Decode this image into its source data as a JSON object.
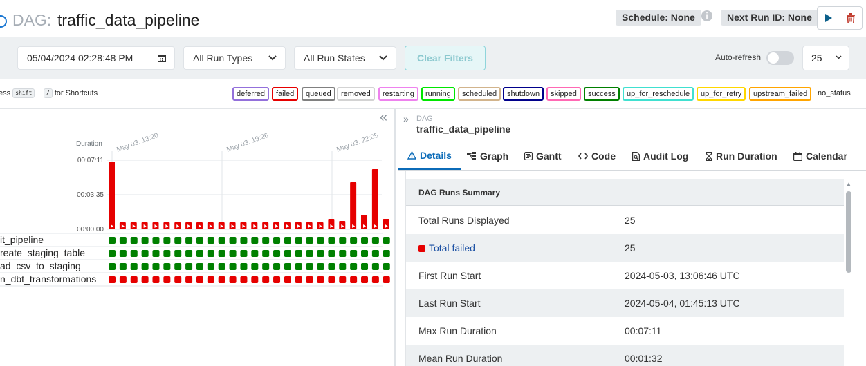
{
  "header": {
    "dag_prefix": "DAG:",
    "dag_title": "traffic_data_pipeline",
    "schedule": "Schedule: None",
    "next_run": "Next Run ID: None",
    "info_icon": "i"
  },
  "filters": {
    "date": "05/04/2024 02:28:48 PM",
    "run_types": "All Run Types",
    "run_states": "All Run States",
    "clear": "Clear Filters",
    "auto_refresh": "Auto-refresh",
    "auto_refresh_on": false,
    "page_size": "25"
  },
  "shortcuts": {
    "prefix": "ess",
    "key1": "shift",
    "plus": "+",
    "key2": "/",
    "suffix": "for Shortcuts"
  },
  "legend": [
    {
      "label": "deferred",
      "color": "#9370db"
    },
    {
      "label": "failed",
      "color": "#e60000"
    },
    {
      "label": "queued",
      "color": "#808080"
    },
    {
      "label": "removed",
      "color": "#d3d3d3"
    },
    {
      "label": "restarting",
      "color": "#ee82ee"
    },
    {
      "label": "running",
      "color": "#00e600"
    },
    {
      "label": "scheduled",
      "color": "#d2b48c"
    },
    {
      "label": "shutdown",
      "color": "#00008b"
    },
    {
      "label": "skipped",
      "color": "#ff69b4"
    },
    {
      "label": "success",
      "color": "#008000"
    },
    {
      "label": "up_for_reschedule",
      "color": "#40e0d0"
    },
    {
      "label": "up_for_retry",
      "color": "#ffd700"
    },
    {
      "label": "upstream_failed",
      "color": "#ffa500"
    }
  ],
  "no_status": "no_status",
  "grid": {
    "duration_label": "Duration",
    "y_ticks": [
      "00:07:11",
      "00:03:35",
      "00:00:00"
    ],
    "date_labels": [
      "May 03, 13:20",
      "May 03, 19:26",
      "May 03, 22:05"
    ],
    "run_durations": [
      0.98,
      0.1,
      0.1,
      0.1,
      0.1,
      0.1,
      0.1,
      0.1,
      0.1,
      0.1,
      0.1,
      0.1,
      0.1,
      0.1,
      0.1,
      0.1,
      0.1,
      0.1,
      0.1,
      0.1,
      0.15,
      0.12,
      0.68,
      0.21,
      0.87,
      0.15,
      0.4
    ],
    "tasks": [
      {
        "label": "it_pipeline",
        "status": "success"
      },
      {
        "label": "reate_staging_table",
        "status": "success"
      },
      {
        "label": "ad_csv_to_staging",
        "status": "success"
      },
      {
        "label": "n_dbt_transformations",
        "status": "failed"
      }
    ]
  },
  "panel": {
    "dag_small": "DAG",
    "dag_name": "traffic_data_pipeline",
    "tabs": [
      "Details",
      "Graph",
      "Gantt",
      "Code",
      "Audit Log",
      "Run Duration",
      "Calendar"
    ],
    "summary_title": "DAG Runs Summary",
    "rows": [
      {
        "k": "Total Runs Displayed",
        "v": "25"
      },
      {
        "k": "Total failed",
        "v": "25"
      },
      {
        "k": "First Run Start",
        "v": "2024-05-03, 13:06:46 UTC"
      },
      {
        "k": "Last Run Start",
        "v": "2024-05-04, 01:45:13 UTC"
      },
      {
        "k": "Max Run Duration",
        "v": "00:07:11"
      },
      {
        "k": "Mean Run Duration",
        "v": "00:01:32"
      }
    ]
  },
  "colors": {
    "failed": "#e60000",
    "success": "#008000",
    "accent": "#0b6bb8"
  }
}
